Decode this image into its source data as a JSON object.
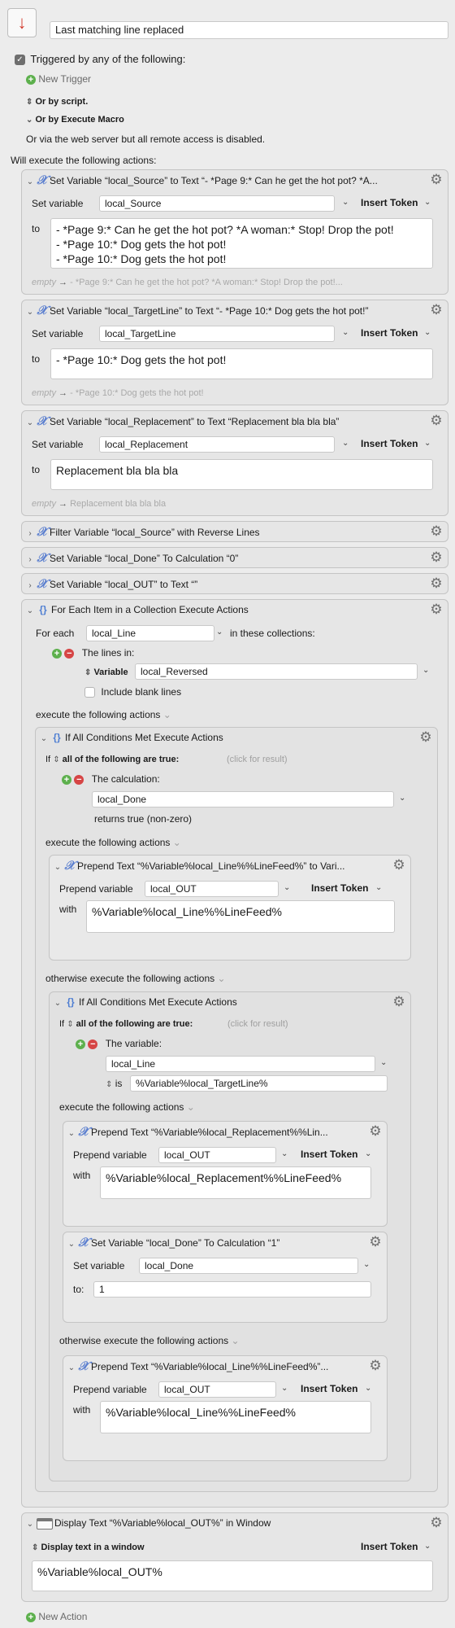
{
  "macro": {
    "title": "Last matching line replaced",
    "icon": "red-down-arrow-icon"
  },
  "triggers": {
    "checkbox_label": "Triggered by any of the following:",
    "new_trigger": "New Trigger",
    "by_script": "Or by script.",
    "by_execute": "Or by Execute Macro",
    "web": "Or via the web server but all remote access is disabled."
  },
  "will_execute": "Will execute the following actions:",
  "a1": {
    "title": "Set Variable “local_Source” to Text “- *Page 9:* Can he get the hot pot? *A...",
    "lbl": "Set variable",
    "var": "local_Source",
    "token": "Insert Token",
    "to": "to",
    "text": "- *Page 9:* Can he get the hot pot? *A woman:* Stop! Drop the pot!\n- *Page 10:* Dog gets the hot pot!\n- *Page 10:* Dog gets the hot pot!",
    "prev_empty": "empty",
    "prev_val": "- *Page 9:* Can he get the hot pot? *A woman:* Stop! Drop the pot!..."
  },
  "a2": {
    "title": "Set Variable “local_TargetLine” to Text “- *Page 10:* Dog gets the hot pot!”",
    "lbl": "Set variable",
    "var": "local_TargetLine",
    "token": "Insert Token",
    "to": "to",
    "text": "- *Page 10:* Dog gets the hot pot!",
    "prev_empty": "empty",
    "prev_val": "- *Page 10:* Dog gets the hot pot!"
  },
  "a3": {
    "title": "Set Variable “local_Replacement” to Text “Replacement bla bla bla”",
    "lbl": "Set variable",
    "var": "local_Replacement",
    "token": "Insert Token",
    "to": "to",
    "text": "Replacement bla bla bla",
    "prev_empty": "empty",
    "prev_val": "Replacement bla bla bla"
  },
  "a4": {
    "title": "Filter Variable “local_Source” with Reverse Lines"
  },
  "a5": {
    "title": "Set Variable “local_Done” To Calculation “0”"
  },
  "a6": {
    "title": "Set Variable “local_OUT” to Text “”"
  },
  "fe": {
    "title": "For Each Item in a Collection Execute Actions",
    "for_each": "For each",
    "var": "local_Line",
    "collections": "in these collections:",
    "lines_in": "The lines in:",
    "variable_lbl": "Variable",
    "variable": "local_Reversed",
    "blank": "Include blank lines",
    "execute": "execute the following actions"
  },
  "if1": {
    "title": "If All Conditions Met Execute Actions",
    "if": "If",
    "all": "all of the following are true:",
    "click": "(click for result)",
    "calc": "The calculation:",
    "calc_val": "local_Done",
    "returns": "returns true (non-zero)",
    "execute": "execute the following actions",
    "otherwise": "otherwise execute the following actions"
  },
  "p1": {
    "title": "Prepend Text “%Variable%local_Line%%LineFeed%” to Vari...",
    "lbl": "Prepend variable",
    "var": "local_OUT",
    "token": "Insert Token",
    "with": "with",
    "text": "%Variable%local_Line%%LineFeed%"
  },
  "if2": {
    "title": "If All Conditions Met Execute Actions",
    "if": "If",
    "all": "all of the following are true:",
    "click": "(click for result)",
    "var_lbl": "The variable:",
    "var_val": "local_Line",
    "is": "is",
    "is_val": "%Variable%local_TargetLine%",
    "execute": "execute the following actions",
    "otherwise": "otherwise execute the following actions"
  },
  "p2": {
    "title": "Prepend Text “%Variable%local_Replacement%%Lin...",
    "lbl": "Prepend variable",
    "var": "local_OUT",
    "token": "Insert Token",
    "with": "with",
    "text": "%Variable%local_Replacement%%LineFeed%"
  },
  "s2": {
    "title": "Set Variable “local_Done” To Calculation “1”",
    "lbl": "Set variable",
    "var": "local_Done",
    "to": "to:",
    "val": "1"
  },
  "p3": {
    "title": "Prepend Text “%Variable%local_Line%%LineFeed%”...",
    "lbl": "Prepend variable",
    "var": "local_OUT",
    "token": "Insert Token",
    "with": "with",
    "text": "%Variable%local_Line%%LineFeed%"
  },
  "disp": {
    "title": "Display Text “%Variable%local_OUT%” in Window",
    "mode": "Display text in a window",
    "token": "Insert Token",
    "text": "%Variable%local_OUT%"
  },
  "new_action": "New Action"
}
